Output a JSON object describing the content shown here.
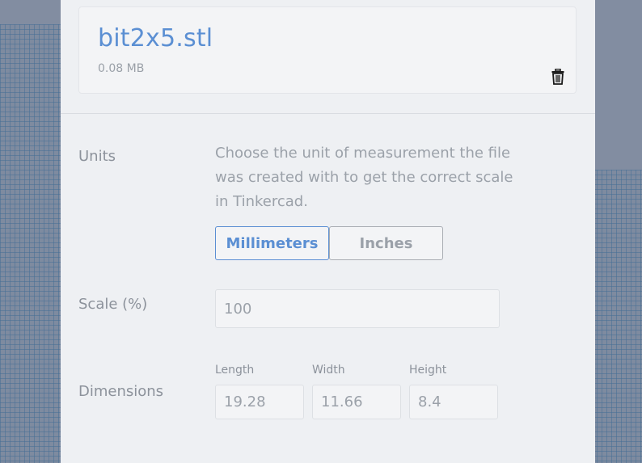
{
  "file": {
    "name": "bit2x5.stl",
    "size": "0.08 MB"
  },
  "units": {
    "label": "Units",
    "description": "Choose the unit of measurement the file was created with to get the correct scale in Tinkercad.",
    "options": [
      "Millimeters",
      "Inches"
    ],
    "selected": "Millimeters"
  },
  "scale": {
    "label": "Scale (%)",
    "value": "100"
  },
  "dimensions": {
    "label": "Dimensions",
    "length_label": "Length",
    "length_value": "19.28",
    "width_label": "Width",
    "width_value": "11.66",
    "height_label": "Height",
    "height_value": "8.4"
  },
  "colors": {
    "accent": "#5b8fd3",
    "panel_bg": "#eef0f3"
  },
  "icons": {
    "delete": "trash-icon"
  }
}
